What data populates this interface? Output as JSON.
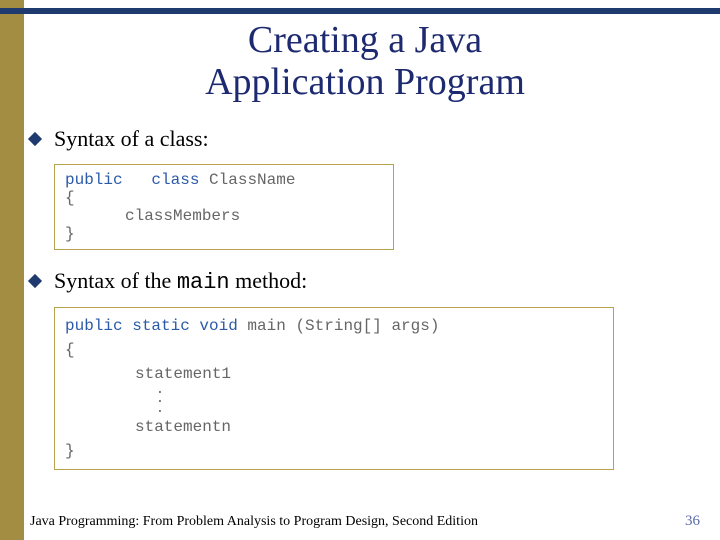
{
  "title_line1": "Creating a Java",
  "title_line2": "Application Program",
  "bullet1": "Syntax of a class:",
  "bullet2_prefix": "Syntax of the ",
  "bullet2_mono": "main",
  "bullet2_suffix": " method:",
  "code1": {
    "kw_public": "public",
    "kw_class": "class",
    "classname": "ClassName",
    "open": "{",
    "members": "classMembers",
    "close": "}"
  },
  "code2": {
    "kw_psv": "public static void",
    "sig_rest": " main (String[] args)",
    "open": "{",
    "stmt1": "statement1",
    "dot": ".",
    "stmtn": "statementn",
    "close": "}"
  },
  "footer_text": "Java Programming: From Problem Analysis to Program Design, Second Edition",
  "page_number": "36"
}
